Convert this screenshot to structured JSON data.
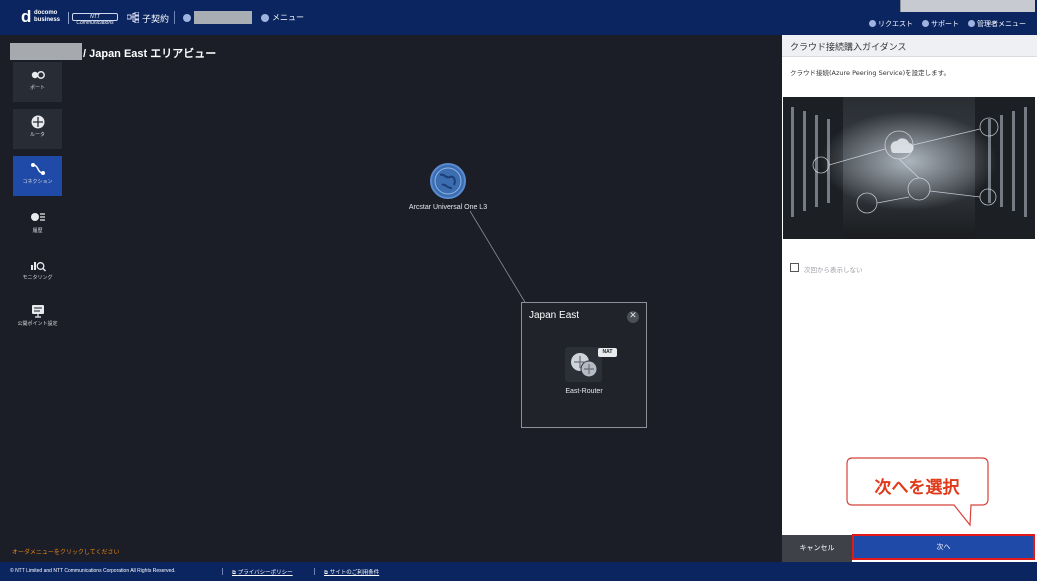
{
  "header": {
    "logo_letter": "d",
    "logo_text_1": "docomo",
    "logo_text_2": "business",
    "ntt_logo": "NTT Communications",
    "contract_label": "子契約",
    "menu_label": "メニュー",
    "request_label": "リクエスト",
    "support_label": "サポート",
    "admin_menu_label": "管理者メニュー"
  },
  "breadcrumb": {
    "text": "/ Japan East エリアビュー"
  },
  "sidebar": {
    "items": [
      {
        "label": "ポート",
        "icon": "port-icon"
      },
      {
        "label": "ルータ",
        "icon": "router-icon"
      },
      {
        "label": "コネクション",
        "icon": "connection-icon",
        "active": true
      },
      {
        "label": "履歴",
        "icon": "history-icon"
      },
      {
        "label": "モニタリング",
        "icon": "monitoring-icon"
      },
      {
        "label": "公開ポイント設定",
        "icon": "public-point-icon"
      }
    ]
  },
  "canvas": {
    "cloud_node_label": "Arcstar Universal One L3",
    "area_title": "Japan East",
    "area_close": "✕",
    "router_badge": "NAT",
    "router_label": "East-Router",
    "order_hint": "オーダメニューをクリックしてください"
  },
  "guide_panel": {
    "title": "クラウド接続購入ガイダンス",
    "description": "クラウド接続(Azure Peering Service)を設定します。",
    "checkbox_label": "次回から表示しない",
    "checkbox_checked": false,
    "cancel_label": "キャンセル",
    "next_label": "次へ"
  },
  "callout": {
    "text": "次へを選択"
  },
  "footer": {
    "copyright": "© NTT Limited and NTT Communications Corporation All Rights Reserved.",
    "privacy_label": "プライバシーポリシー",
    "terms_label": "サイトのご利用条件"
  },
  "colors": {
    "header_bg": "#0a2560",
    "canvas_bg": "#1b1e26",
    "accent_blue": "#1f4aa8",
    "highlight_red": "#e31818",
    "hint_orange": "#e8841a",
    "callout_text": "#e03a1a"
  }
}
